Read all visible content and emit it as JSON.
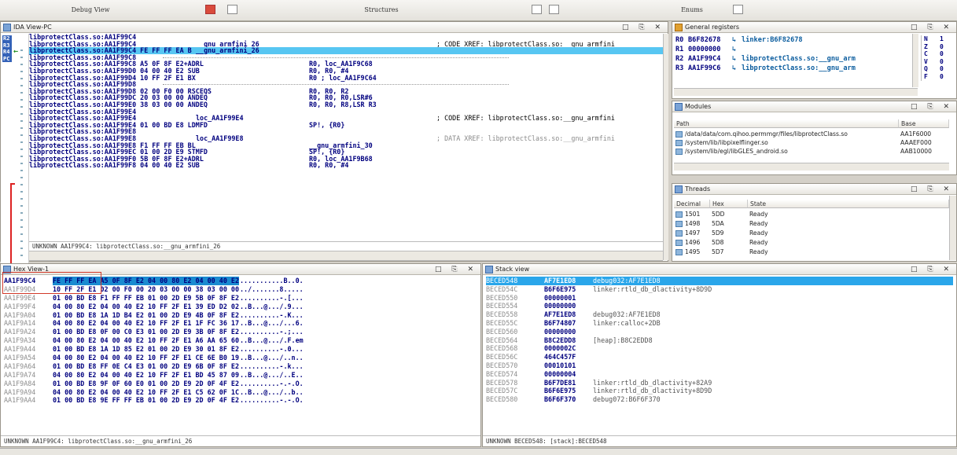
{
  "top_tabs": [
    {
      "label": "Debug View"
    },
    {
      "label": "Structures"
    },
    {
      "label": "Enums"
    }
  ],
  "ida_view": {
    "title": "IDA View-PC",
    "gutter_regs": [
      "R2",
      "R3",
      "R4",
      "PC"
    ],
    "lines": [
      {
        "addr": "libprotectClass.so:AA1F99C4",
        "label": "",
        "op": "",
        "comment": ""
      },
      {
        "addr": "libprotectClass.so:AA1F99C4",
        "label": "__gnu_armfini_26",
        "op": "",
        "comment": "; CODE XREF: libprotectClass.so:__gnu_armfini"
      },
      {
        "addr": "libprotectClass.so:AA1F99C4 FE FF FF EA B",
        "label": "__gnu_armfini_26",
        "op": "",
        "comment": "",
        "highlight": true
      },
      {
        "addr": "libprotectClass.so:AA1F99C8",
        "label": "",
        "op": "",
        "comment": "",
        "sep": true
      },
      {
        "addr": "libprotectClass.so:AA1F99C8 A5 0F 8F E2+ADRL",
        "label": "",
        "op": "R0, loc_AA1F9C68",
        "comment": ""
      },
      {
        "addr": "libprotectClass.so:AA1F99D0 04 00 40 E2 SUB",
        "label": "",
        "op": "R0, R0, #4",
        "comment": ""
      },
      {
        "addr": "libprotectClass.so:AA1F99D4 10 FF 2F E1 BX",
        "label": "",
        "op": "R0 ; loc_AA1F9C64",
        "comment": ""
      },
      {
        "addr": "libprotectClass.so:AA1F99D8",
        "label": "",
        "op": "",
        "comment": "",
        "sep": true
      },
      {
        "addr": "libprotectClass.so:AA1F99D8 02 00 F0 00 RSCEQS",
        "label": "",
        "op": "R0, R0, R2",
        "comment": ""
      },
      {
        "addr": "libprotectClass.so:AA1F99DC 20 03 00 00 ANDEQ",
        "label": "",
        "op": "R0, R0, R0,LSR#6",
        "comment": ""
      },
      {
        "addr": "libprotectClass.so:AA1F99E0 38 03 00 00 ANDEQ",
        "label": "",
        "op": "R0, R0, R8,LSR R3",
        "comment": ""
      },
      {
        "addr": "libprotectClass.so:AA1F99E4",
        "label": "",
        "op": "",
        "comment": ""
      },
      {
        "addr": "libprotectClass.so:AA1F99E4",
        "label": "loc_AA1F99E4",
        "op": "",
        "comment": "; CODE XREF: libprotectClass.so:__gnu_armfini"
      },
      {
        "addr": "libprotectClass.so:AA1F99E4 01 00 BD E8 LDMFD",
        "label": "",
        "op": "SP!, {R0}",
        "comment": ""
      },
      {
        "addr": "libprotectClass.so:AA1F99E8",
        "label": "",
        "op": "",
        "comment": ""
      },
      {
        "addr": "libprotectClass.so:AA1F99E8",
        "label": "loc_AA1F99E8",
        "op": "",
        "comment": "; DATA XREF: libprotectClass.so:__gnu_armfini",
        "dim": true
      },
      {
        "addr": "libprotectClass.so:AA1F99E8 F1 FF FF EB BL",
        "label": "",
        "op": "__gnu_armfini_30",
        "comment": ""
      },
      {
        "addr": "libprotectClass.so:AA1F99EC 01 00 2D E9 STMFD",
        "label": "",
        "op": "SP!, {R0}",
        "comment": ""
      },
      {
        "addr": "libprotectClass.so:AA1F99F0 5B 0F 8F E2+ADRL",
        "label": "",
        "op": "R0, loc_AA1F9B68",
        "comment": ""
      },
      {
        "addr": "libprotectClass.so:AA1F99F8 04 00 40 E2 SUB",
        "label": "",
        "op": "R0, R0, #4",
        "comment": ""
      }
    ],
    "status": "UNKNOWN AA1F99C4: libprotectClass.so:__gnu_armfini_26"
  },
  "registers": {
    "title": "General registers",
    "rows": [
      {
        "name": "R0",
        "value": "B6F82678",
        "link": "linker:B6F82678"
      },
      {
        "name": "R1",
        "value": "00000000",
        "link": ""
      },
      {
        "name": "R2",
        "value": "AA1F99C4",
        "link": "libprotectClass.so:__gnu_arm"
      },
      {
        "name": "R3",
        "value": "AA1F99C6",
        "link": "libprotectClass.so:__gnu_arm"
      }
    ],
    "flags": [
      {
        "name": "N",
        "value": "1"
      },
      {
        "name": "Z",
        "value": "0"
      },
      {
        "name": "C",
        "value": "0"
      },
      {
        "name": "V",
        "value": "0"
      },
      {
        "name": "Q",
        "value": "0"
      },
      {
        "name": "F",
        "value": "0"
      }
    ]
  },
  "modules": {
    "title": "Modules",
    "col_path": "Path",
    "col_base": "Base",
    "rows": [
      {
        "path": "/data/data/com.qihoo.permmgr/files/libprotectClass.so",
        "base": "AA1F6000"
      },
      {
        "path": "/system/lib/libpixelflinger.so",
        "base": "AAAEF000"
      },
      {
        "path": "/system/lib/egl/libGLES_android.so",
        "base": "AAB10000"
      }
    ]
  },
  "threads": {
    "title": "Threads",
    "cols": [
      "Decimal",
      "Hex",
      "State"
    ],
    "rows": [
      {
        "dec": "1501",
        "hex": "5DD",
        "state": "Ready"
      },
      {
        "dec": "1498",
        "hex": "5DA",
        "state": "Ready"
      },
      {
        "dec": "1497",
        "hex": "5D9",
        "state": "Ready"
      },
      {
        "dec": "1496",
        "hex": "5D8",
        "state": "Ready"
      },
      {
        "dec": "1495",
        "hex": "5D7",
        "state": "Ready"
      }
    ]
  },
  "hex_view": {
    "title": "Hex View-1",
    "rows": [
      {
        "addr": "AA1F99C4",
        "bytes": "FE FF FF EA A5 0F 8F E2  04 00 80 E2 04 00 40 E2",
        "ascii": "...........B..0.",
        "current": true
      },
      {
        "addr": "AA1F99D4",
        "bytes": "10 FF 2F E1 02 00 F0 00  20 03 00 00 38 03 00 00",
        "ascii": "../.......8....."
      },
      {
        "addr": "AA1F99E4",
        "bytes": "01 00 BD E8 F1 FF FF EB  01 00 2D E9 5B 0F 8F E2",
        "ascii": "..........-.[..."
      },
      {
        "addr": "AA1F99F4",
        "bytes": "04 00 80 E2 04 00 40 E2  10 FF 2F E1 39 ED D2 02",
        "ascii": "..B...@.../.9..."
      },
      {
        "addr": "AA1F9A04",
        "bytes": "01 00 BD E8 1A 1D B4 E2  01 00 2D E9 4B 0F 8F E2",
        "ascii": "..........-.K..."
      },
      {
        "addr": "AA1F9A14",
        "bytes": "04 00 80 E2 04 00 40 E2  10 FF 2F E1 1F FC 36 17",
        "ascii": "..B...@.../...6."
      },
      {
        "addr": "AA1F9A24",
        "bytes": "01 00 BD E8 0F 00 C0 E3  01 00 2D E9 3B 0F 8F E2",
        "ascii": "..........-.;..."
      },
      {
        "addr": "AA1F9A34",
        "bytes": "04 00 80 E2 04 00 40 E2  10 FF 2F E1 A6 AA 65 60",
        "ascii": "..B...@.../.F.em"
      },
      {
        "addr": "AA1F9A44",
        "bytes": "01 00 BD E8 1A 1D 85 E2  01 00 2D E9 30 01 8F E2",
        "ascii": "..........-.0..."
      },
      {
        "addr": "AA1F9A54",
        "bytes": "04 00 80 E2 04 00 40 E2  10 FF 2F E1 CE 6E B0 19",
        "ascii": "..B...@.../..n.."
      },
      {
        "addr": "AA1F9A64",
        "bytes": "01 00 BD E8 FF 0E C4 E3  01 00 2D E9 6B 0F 8F E2",
        "ascii": "..........-.k..."
      },
      {
        "addr": "AA1F9A74",
        "bytes": "04 00 80 E2 04 00 40 E2  10 FF 2F E1 BD 45 87 09",
        "ascii": "..B...@.../..E.."
      },
      {
        "addr": "AA1F9A84",
        "bytes": "01 00 BD E8 9F 0F 60 E0  01 00 2D E9 2D 0F 4F E2",
        "ascii": "..........-.-.O."
      },
      {
        "addr": "AA1F9A94",
        "bytes": "04 00 80 E2 04 00 40 E2  10 FF 2F E1 C5 62 0F 1C",
        "ascii": "..B...@.../..b.."
      },
      {
        "addr": "AA1F9AA4",
        "bytes": "01 00 BD E8 9E FF FF EB  01 00 2D E9 2D 0F 4F E2",
        "ascii": "..........-.-.O."
      }
    ],
    "status": "UNKNOWN AA1F99C4: libprotectClass.so:__gnu_armfini_26"
  },
  "stack_view": {
    "title": "Stack view",
    "rows": [
      {
        "addr": "BECED548",
        "val": "AF7E1ED8",
        "comment": "debug032:AF7E1ED8",
        "hl": true
      },
      {
        "addr": "BECED54C",
        "val": "B6F6E975",
        "comment": "linker:rtld_db_dlactivity+8D9D"
      },
      {
        "addr": "BECED550",
        "val": "00000001",
        "comment": ""
      },
      {
        "addr": "BECED554",
        "val": "00000000",
        "comment": ""
      },
      {
        "addr": "BECED558",
        "val": "AF7E1ED8",
        "comment": "debug032:AF7E1ED8"
      },
      {
        "addr": "BECED55C",
        "val": "B6F74807",
        "comment": "linker:calloc+2DB"
      },
      {
        "addr": "BECED560",
        "val": "00000000",
        "comment": ""
      },
      {
        "addr": "BECED564",
        "val": "B8C2EDD8",
        "comment": "[heap]:B8C2EDD8"
      },
      {
        "addr": "BECED568",
        "val": "0000002C",
        "comment": ""
      },
      {
        "addr": "BECED56C",
        "val": "464C457F",
        "comment": ""
      },
      {
        "addr": "BECED570",
        "val": "00010101",
        "comment": ""
      },
      {
        "addr": "BECED574",
        "val": "00000004",
        "comment": ""
      },
      {
        "addr": "BECED578",
        "val": "B6F7DE81",
        "comment": "linker:rtld_db_dlactivity+82A9"
      },
      {
        "addr": "BECED57C",
        "val": "B6F6E975",
        "comment": "linker:rtld_db_dlactivity+8D9D"
      },
      {
        "addr": "BECED580",
        "val": "B6F6F370",
        "comment": "debug072:B6F6F370"
      }
    ],
    "status": "UNKNOWN BECED548: [stack]:BECED548"
  }
}
